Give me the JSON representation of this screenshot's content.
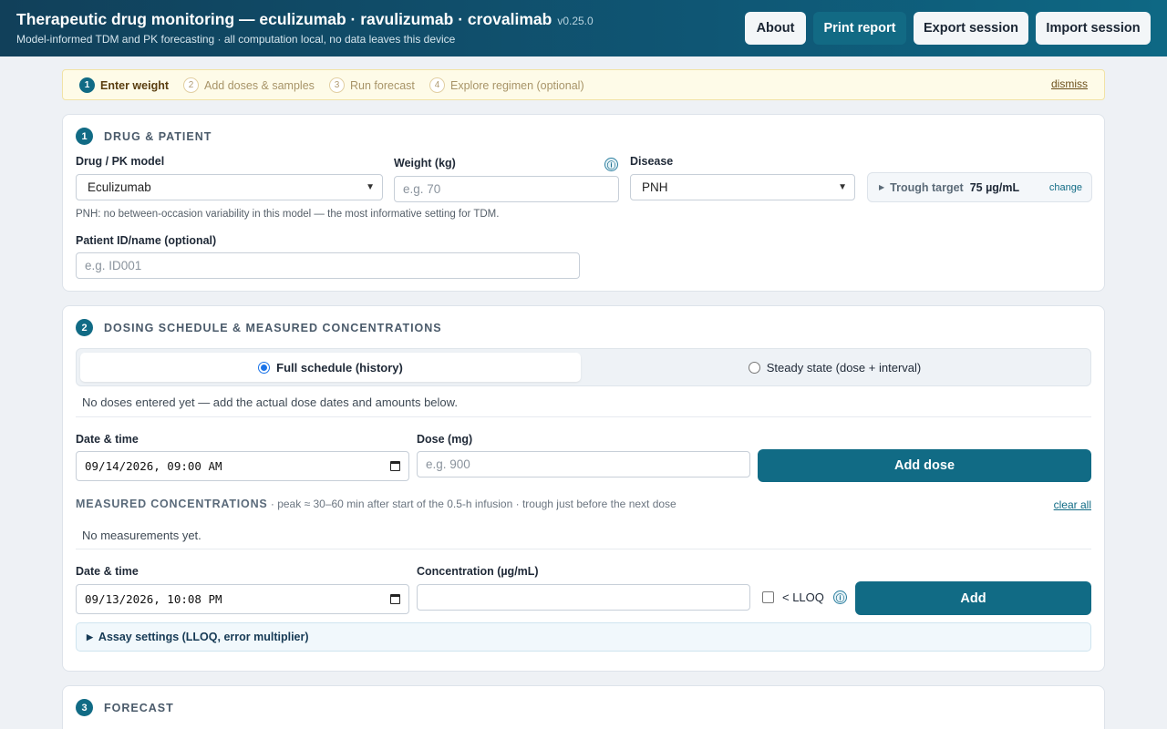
{
  "header": {
    "title": "Therapeutic drug monitoring — eculizumab · ravulizumab · crovalimab",
    "version": "v0.25.0",
    "subtitle": "Model-informed TDM and PK forecasting · all computation local, no data leaves this device",
    "buttons": {
      "about": "About",
      "print": "Print report",
      "export": "Export session",
      "import": "Import session"
    }
  },
  "stepper": {
    "steps": [
      {
        "num": "1",
        "label": "Enter weight"
      },
      {
        "num": "2",
        "label": "Add doses & samples"
      },
      {
        "num": "3",
        "label": "Run forecast"
      },
      {
        "num": "4",
        "label": "Explore regimen (optional)"
      }
    ],
    "active_step": 1,
    "dismiss": "dismiss"
  },
  "section1": {
    "num": "1",
    "title": "Drug & patient",
    "drug_label": "Drug / PK model",
    "drug_value": "Eculizumab",
    "weight_label": "Weight (kg)",
    "weight_placeholder": "e.g. 70",
    "disease_label": "Disease",
    "disease_value": "PNH",
    "trough_label": "Trough target",
    "trough_value": "75 µg/mL",
    "trough_change": "change",
    "note": "PNH: no between-occasion variability in this model — the most informative setting for TDM.",
    "patient_label": "Patient ID/name (optional)",
    "patient_placeholder": "e.g. ID001"
  },
  "section2": {
    "num": "2",
    "title": "Dosing schedule & measured concentrations",
    "mode_full": "Full schedule (history)",
    "mode_steady": "Steady state (dose + interval)",
    "selected_mode": "full",
    "no_doses": "No doses entered yet — add the actual dose dates and amounts below.",
    "dose_date_label": "Date & time",
    "dose_date_value": "09/14/2026, 09:00 AM",
    "dose_label": "Dose (mg)",
    "dose_placeholder": "e.g. 900",
    "add_dose": "Add dose",
    "meas_title": "Measured concentrations",
    "meas_desc": " · peak ≈ 30–60 min after start of the 0.5-h infusion · trough just before the next dose",
    "clear_all": "clear all",
    "no_meas": "No measurements yet.",
    "meas_date_label": "Date & time",
    "meas_date_value": "09/13/2026, 10:08 PM",
    "conc_label": "Concentration (µg/mL)",
    "lloq_label": "< LLOQ",
    "lloq_checked": false,
    "add": "Add",
    "assay": "Assay settings (LLOQ, error multiplier)"
  },
  "section3": {
    "num": "3",
    "title": "Forecast"
  },
  "icons": {
    "info": "ⓘ"
  }
}
